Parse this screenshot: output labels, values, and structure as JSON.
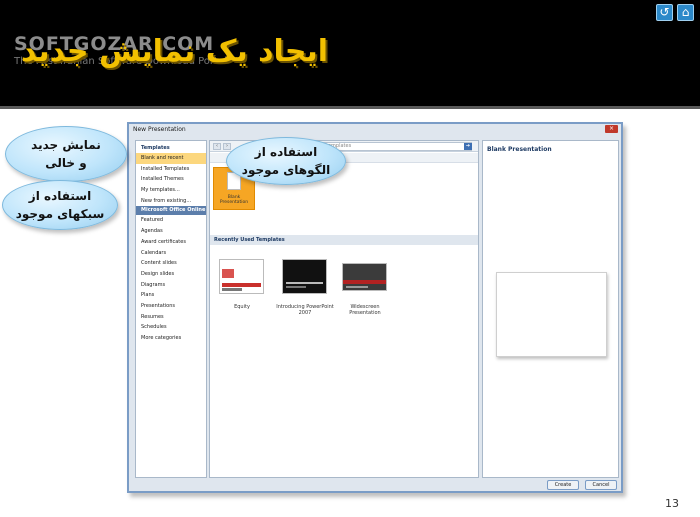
{
  "slide": {
    "title": "ایجاد یک نمایش جدید",
    "watermark_main": "SOFTGOZAR.COM",
    "watermark_sub": "The First Iranian Software Download Portal",
    "page_number": "13",
    "nav": {
      "back_icon": "↺",
      "home_icon": "⌂"
    }
  },
  "dialog": {
    "title": "New Presentation",
    "close_icon": "×",
    "left_pane": {
      "header": "Templates",
      "items": [
        "Blank and recent",
        "Installed Templates",
        "Installed Themes",
        "My templates...",
        "New from existing..."
      ],
      "section": "Microsoft Office Online",
      "online_items": [
        "Featured",
        "Agendas",
        "Award certificates",
        "Calendars",
        "Content slides",
        "Design slides",
        "Diagrams",
        "Plans",
        "Presentations",
        "Resumes",
        "Schedules",
        "More categories"
      ]
    },
    "middle_pane": {
      "search_placeholder": "templates",
      "blank_label": "Blank Presentation",
      "recent_header": "Recently Used Templates",
      "recent": [
        {
          "label": "Equity"
        },
        {
          "label": "Introducing PowerPoint 2007"
        },
        {
          "label": "Widescreen Presentation"
        }
      ]
    },
    "right_pane": {
      "title": "Blank Presentation"
    },
    "buttons": {
      "create": "Create",
      "cancel": "Cancel"
    }
  },
  "callouts": {
    "new_blank": {
      "line1": "نمایش جدید",
      "line2": "و خالی"
    },
    "templates": {
      "line1": "استفاده از",
      "line2": "الگوهای موجود"
    },
    "themes": {
      "line1": "استفاده از",
      "line2": "سبکهای موجود"
    }
  },
  "colors": {
    "banner": "#000000",
    "title": "#f2c000",
    "selected": "#fcd77e",
    "accent": "#5c7eab",
    "callout": "#bfe5fb"
  }
}
